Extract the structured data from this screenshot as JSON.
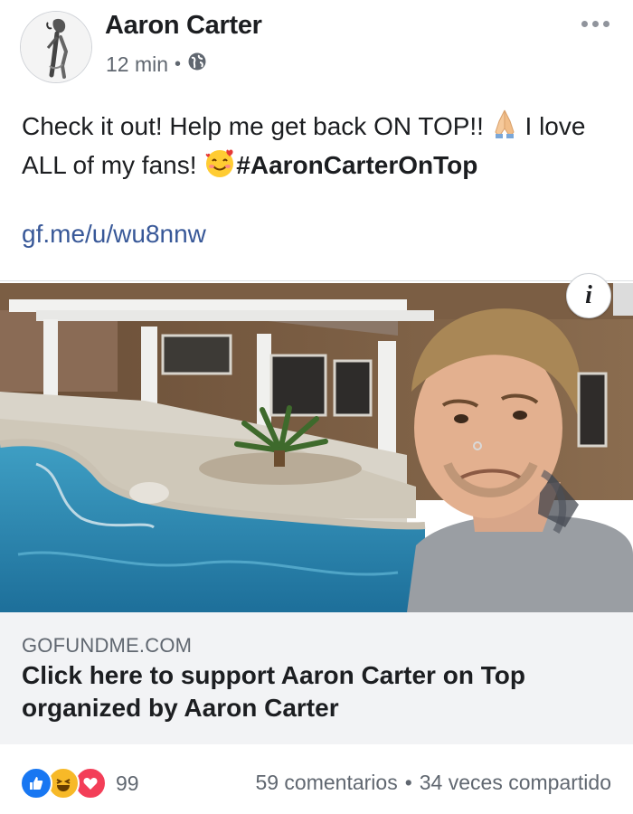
{
  "post": {
    "author": "Aaron Carter",
    "time": "12 min",
    "separator": "•",
    "privacy_icon": "globe-icon",
    "text_part1": "Check it out! Help me get back ON TOP!! ",
    "text_part2": " I love ALL of my fans! ",
    "hashtag": "#AaronCarterOnTop",
    "link": "gf.me/u/wu8nnw"
  },
  "link_card": {
    "domain": "GOFUNDME.COM",
    "title_line1": "Click here to support Aaron Carter on Top",
    "title_line2": "organized by Aaron Carter",
    "info_label": "i"
  },
  "footer": {
    "reaction_count": "99",
    "comments": "59 comentarios",
    "dot": "•",
    "shares": "34 veces compartido"
  },
  "colors": {
    "link": "#385898",
    "like_blue": "#1877f2",
    "haha_yellow": "#f7b928",
    "love_red": "#f33e58",
    "caption_bg": "#f2f3f5"
  }
}
